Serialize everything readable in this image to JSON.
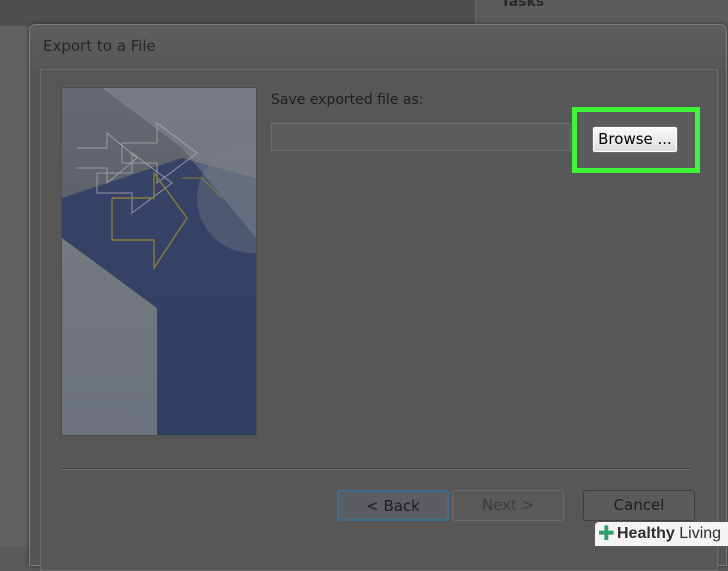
{
  "background": {
    "right_panel_title": "Tasks"
  },
  "dialog": {
    "title": "Export to a File",
    "save_label": "Save exported file as:",
    "path_value": "",
    "browse_label": "Browse ...",
    "back_label": "< Back",
    "next_label": "Next >",
    "cancel_label": "Cancel"
  },
  "watermark": {
    "brand_bold": "Healthy",
    "brand_regular": " Living"
  },
  "colors": {
    "highlight": "#3df63a",
    "accent_border": "#3f6f8f"
  }
}
